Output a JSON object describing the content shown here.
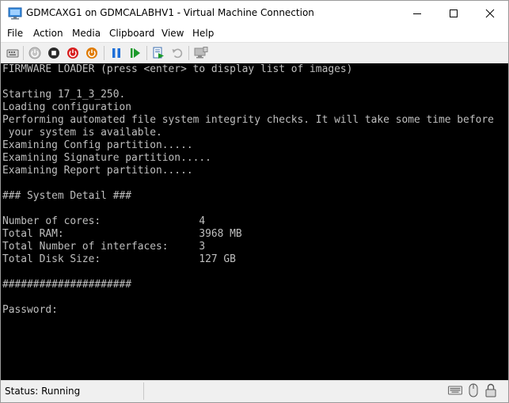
{
  "window": {
    "title": "GDMCAXG1 on GDMCALABHV1 - Virtual Machine Connection"
  },
  "menu": {
    "items": [
      "File",
      "Action",
      "Media",
      "Clipboard",
      "View",
      "Help"
    ]
  },
  "toolbar": {
    "icons": [
      "ctrl-alt-del-icon",
      "start-icon",
      "turn-off-icon",
      "shut-down-icon",
      "save-icon",
      "pause-icon",
      "reset-icon",
      "checkpoint-icon",
      "revert-icon",
      "enhanced-session-icon"
    ],
    "colors": {
      "turn_off": "#d81e1e",
      "shut_down": "#e07b00",
      "pause": "#1e6fd8",
      "reset": "#1a9a2a"
    }
  },
  "console": {
    "text_color": "#bfbfbf",
    "background": "#000000",
    "lines": [
      "FIRMWARE LOADER (press <enter> to display list of images)",
      "",
      "Starting 17_1_3_250.",
      "Loading configuration",
      "Performing automated file system integrity checks. It will take some time before",
      " your system is available.",
      "Examining Config partition.....",
      "Examining Signature partition.....",
      "Examining Report partition.....",
      "",
      "### System Detail ###",
      "",
      "Number of cores:                4",
      "Total RAM:                      3968 MB",
      "Total Number of interfaces:     3",
      "Total Disk Size:                127 GB",
      "",
      "#####################",
      "",
      "Password:"
    ]
  },
  "status": {
    "text": "Status: Running",
    "icons": [
      "keyboard-icon",
      "mouse-icon",
      "lock-icon"
    ]
  }
}
